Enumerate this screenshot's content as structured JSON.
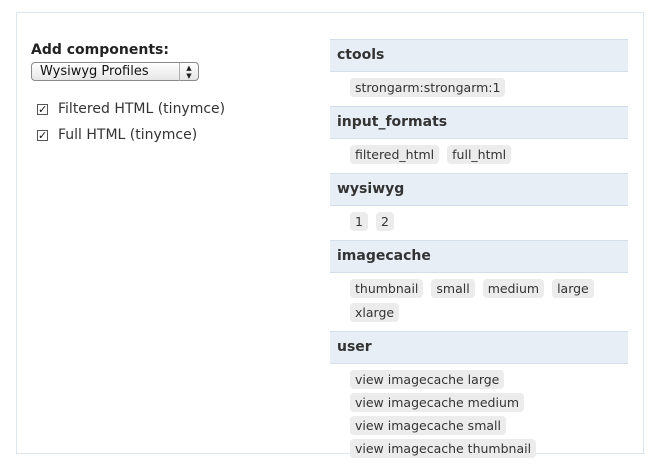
{
  "left": {
    "add_label": "Add components:",
    "select": {
      "value": "Wysiwyg Profiles"
    },
    "checkboxes": [
      {
        "label": "Filtered HTML (tinymce)",
        "checked": true
      },
      {
        "label": "Full HTML (tinymce)",
        "checked": true
      }
    ]
  },
  "sections": [
    {
      "title": "ctools",
      "items": [
        "strongarm:strongarm:1"
      ]
    },
    {
      "title": "input_formats",
      "items": [
        "filtered_html",
        "full_html"
      ]
    },
    {
      "title": "wysiwyg",
      "items": [
        "1",
        "2"
      ]
    },
    {
      "title": "imagecache",
      "items": [
        "thumbnail",
        "small",
        "medium",
        "large",
        "xlarge"
      ]
    },
    {
      "title": "user",
      "items": [
        "view imagecache large",
        "view imagecache medium",
        "view imagecache small",
        "view imagecache thumbnail"
      ]
    }
  ]
}
